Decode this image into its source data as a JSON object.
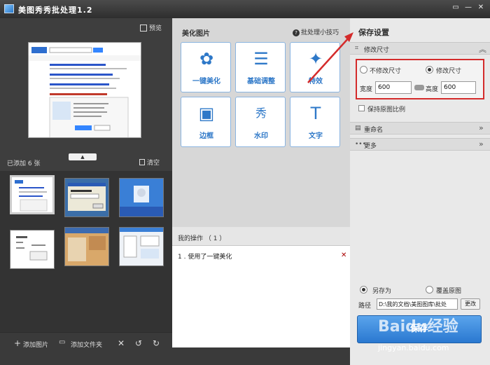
{
  "window": {
    "title": "美图秀秀批处理1.2",
    "buttons": [
      "▭",
      "—",
      "✕"
    ]
  },
  "left": {
    "preview_label": "预览",
    "added_label": "已添加 6 张",
    "clear_label": "清空",
    "bottom": {
      "add_image": "添加图片",
      "add_folder": "添加文件夹"
    }
  },
  "middle": {
    "header": "美化图片",
    "tips_link": "批处理小技巧",
    "tools": [
      {
        "label": "一键美化",
        "glyph": "✿"
      },
      {
        "label": "基础调整",
        "glyph": "☰"
      },
      {
        "label": "特效",
        "glyph": "✦"
      },
      {
        "label": "边框",
        "glyph": "▣"
      },
      {
        "label": "水印",
        "glyph": "秀"
      },
      {
        "label": "文字",
        "glyph": "T"
      }
    ],
    "ops_header": "我的操作 （ 1 ）",
    "ops": [
      {
        "index": "1",
        "text": "使用了一键美化"
      }
    ]
  },
  "right": {
    "header": "保存设置",
    "resize_section": "修改尺寸",
    "keep_size_label": "不修改尺寸",
    "modify_size_label": "修改尺寸",
    "width_label": "宽度",
    "width_value": "600",
    "height_label": "高度",
    "height_value": "600",
    "keep_ratio_label": "保持原图比例",
    "rename_section": "重命名",
    "more_section": "更多",
    "save_as_label": "另存为",
    "overwrite_label": "覆盖原图",
    "path_label": "路径",
    "path_value": "D:\\我的文档\\美图图库\\批处",
    "change_label": "更改",
    "save_button": "保存"
  },
  "watermark": {
    "main": "Baidu经验",
    "sub": "jingyan.baidu.com"
  },
  "colors": {
    "accent": "#2e78c8",
    "highlight": "#d42b2b"
  }
}
